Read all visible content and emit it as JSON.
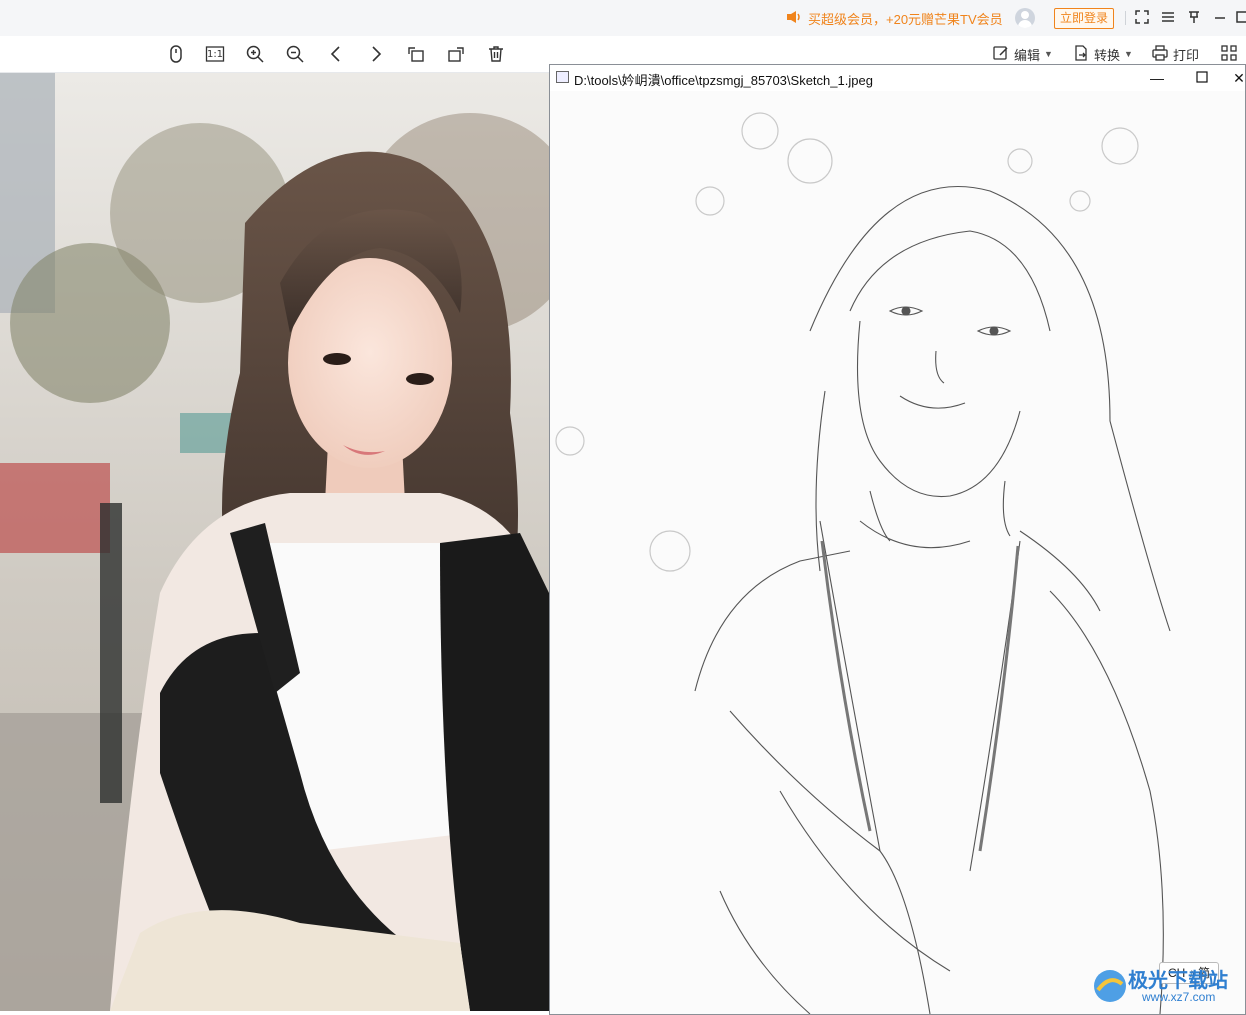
{
  "topbar": {
    "promo_text": "买超级会员，+20元赠芒果TV会员",
    "login_label": "立即登录",
    "icons": [
      "speaker-icon",
      "user-avatar",
      "fullscreen-icon",
      "menu-icon",
      "pin-icon",
      "minimize-icon",
      "maximize-icon"
    ]
  },
  "toolbar": {
    "ratio_label": "1:1",
    "edit_label": "编辑",
    "convert_label": "转换",
    "print_label": "打印"
  },
  "sketch_window": {
    "title": "D:\\tools\\妗岄潰\\office\\tpzsmgj_85703\\Sketch_1.jpeg"
  },
  "ime": {
    "label": "CH ♪ 简"
  },
  "watermark": {
    "text": "极光下载站",
    "url": "www.xz7.com"
  },
  "colors": {
    "accent": "#f0841c",
    "topbar_bg": "#f5f6f8"
  }
}
